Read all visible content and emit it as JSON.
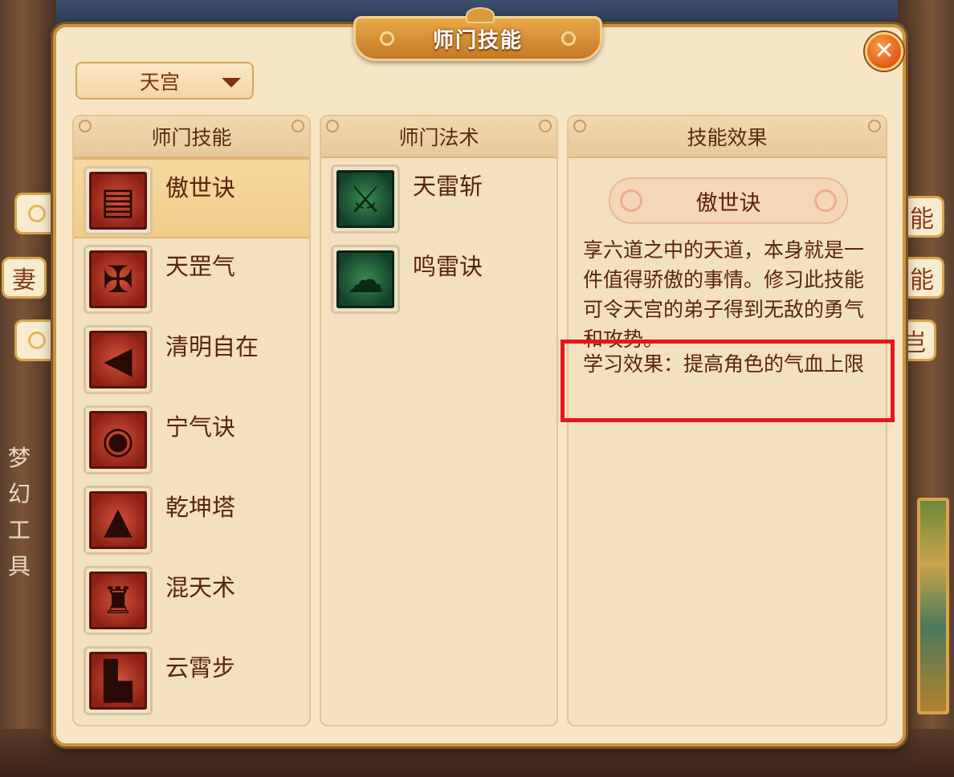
{
  "window": {
    "title": "师门技能",
    "close_icon": "close-icon"
  },
  "faction_dropdown": {
    "selected": "天宫"
  },
  "columns": {
    "skills_header": "师门技能",
    "spells_header": "师门法术",
    "effect_header": "技能效果"
  },
  "skills": [
    {
      "name": "傲世诀",
      "icon": "scroll-gate-icon",
      "selected": true
    },
    {
      "name": "天罡气",
      "icon": "warrior-icon",
      "selected": false
    },
    {
      "name": "清明自在",
      "icon": "horn-icon",
      "selected": false
    },
    {
      "name": "宁气诀",
      "icon": "orb-icon",
      "selected": false
    },
    {
      "name": "乾坤塔",
      "icon": "pagoda-icon",
      "selected": false
    },
    {
      "name": "混天术",
      "icon": "tower-icon",
      "selected": false
    },
    {
      "name": "云霄步",
      "icon": "boot-icon",
      "selected": false
    }
  ],
  "spells": [
    {
      "name": "天雷斩",
      "icon": "thunder-sword-icon"
    },
    {
      "name": "鸣雷诀",
      "icon": "cloud-lightning-icon"
    }
  ],
  "effect": {
    "skill_name": "傲世诀",
    "description": "享六道之中的天道，本身就是一件值得骄傲的事情。修习此技能可令天宫的弟子得到无敌的勇气和攻势。",
    "learn_effect": "学习效果：提高角色的气血上限"
  },
  "background": {
    "vertical_text": "梦幻工具",
    "side_tabs": [
      "",
      "妻",
      "",
      "能",
      "能",
      "岂"
    ]
  },
  "colors": {
    "highlight": "#e8141c",
    "title_plate": "#d38d34",
    "panel_bg": "#f6e6c6"
  }
}
